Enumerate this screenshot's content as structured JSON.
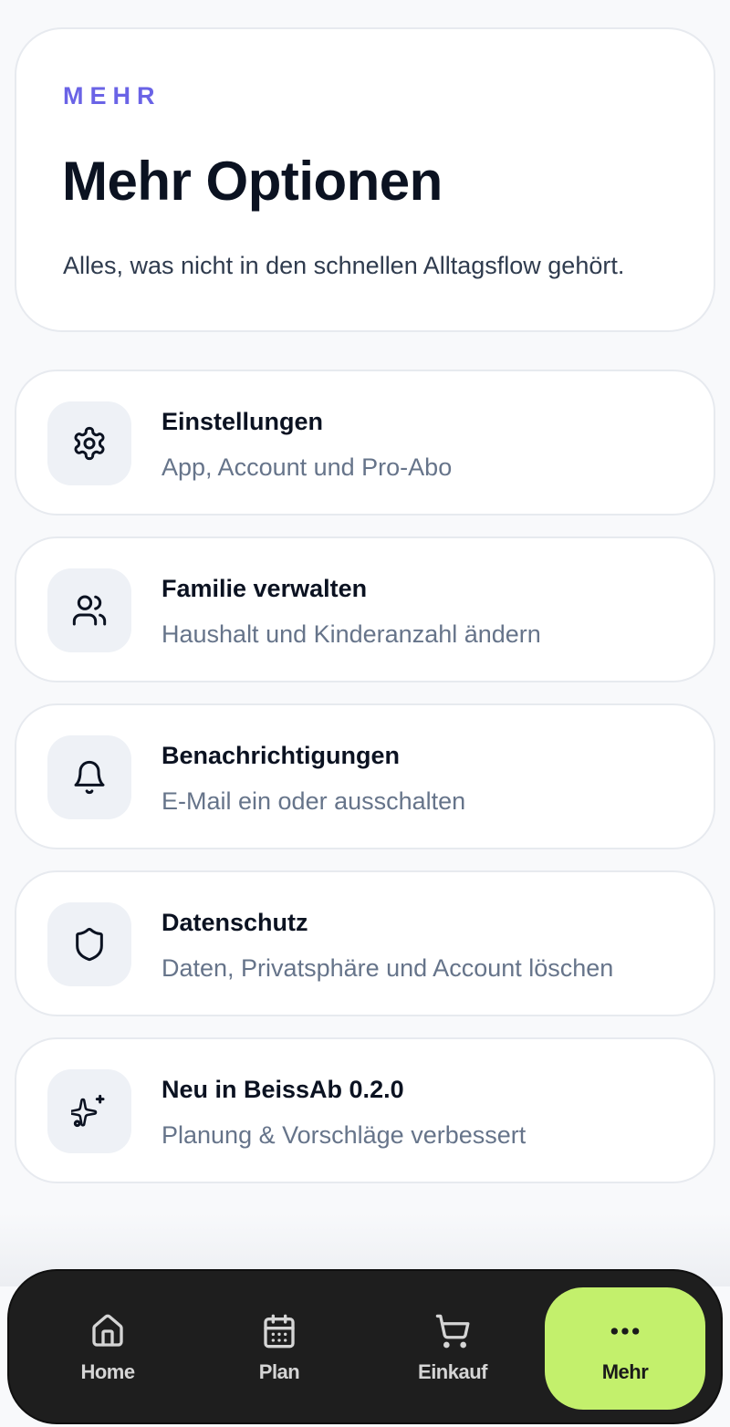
{
  "hero": {
    "eyebrow": "MEHR",
    "title": "Mehr Optionen",
    "subtitle": "Alles, was nicht in den schnellen Alltagsflow gehört."
  },
  "menu": [
    {
      "icon": "gear-icon",
      "title": "Einstellungen",
      "desc": "App, Account und Pro-Abo"
    },
    {
      "icon": "users-icon",
      "title": "Familie verwalten",
      "desc": "Haushalt und Kinderanzahl ändern"
    },
    {
      "icon": "bell-icon",
      "title": "Benachrichtigungen",
      "desc": "E-Mail ein oder ausschalten"
    },
    {
      "icon": "shield-icon",
      "title": "Datenschutz",
      "desc": "Daten, Privatsphäre und Account löschen"
    },
    {
      "icon": "sparkles-icon",
      "title": "Neu in BeissAb 0.2.0",
      "desc": "Planung & Vorschläge verbessert"
    }
  ],
  "nav": {
    "items": [
      {
        "icon": "home-icon",
        "label": "Home"
      },
      {
        "icon": "calendar-icon",
        "label": "Plan"
      },
      {
        "icon": "cart-icon",
        "label": "Einkauf"
      },
      {
        "icon": "more-dots-icon",
        "label": "Mehr"
      }
    ],
    "active": "Mehr"
  },
  "colors": {
    "accent": "#6a63e6",
    "nav_bg": "#1e1e1e",
    "nav_active": "#c3f06c"
  }
}
